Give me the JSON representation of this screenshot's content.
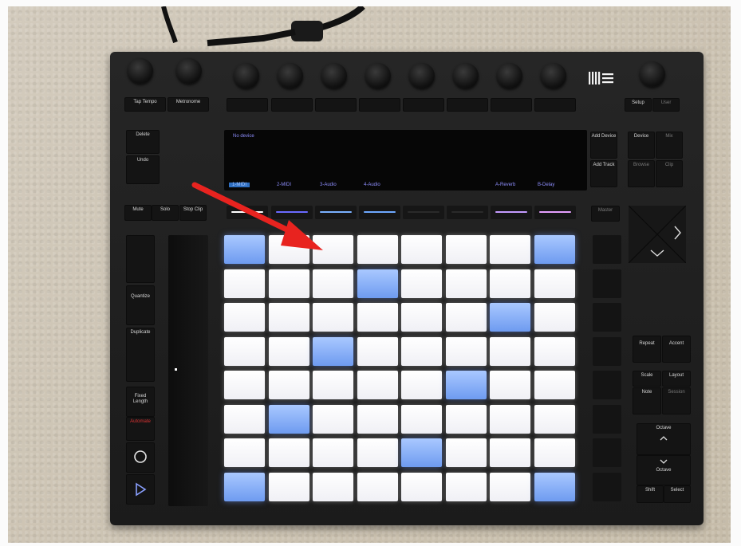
{
  "device": {
    "top_buttons": {
      "tap_tempo": "Tap Tempo",
      "metronome": "Metronome",
      "setup": "Setup",
      "user": "User"
    },
    "left_buttons": {
      "delete": "Delete",
      "undo": "Undo",
      "mute": "Mute",
      "solo": "Solo",
      "stop_clip": "Stop Clip",
      "quantize": "Quantize",
      "duplicate": "Duplicate",
      "fixed_length": "Fixed Length",
      "automate": "Automate",
      "record_icon": "record-icon",
      "play_icon": "play-icon"
    },
    "display": {
      "status": "No device",
      "tracks": [
        "1-MIDI",
        "2-MIDI",
        "3-Audio",
        "4-Audio",
        "A-Reverb",
        "B-Delay"
      ],
      "selected_track": "1-MIDI"
    },
    "right_buttons": {
      "add_device": "Add Device",
      "add_track": "Add Track",
      "device": "Device",
      "mix": "Mix",
      "browse": "Browse",
      "clip": "Clip",
      "master": "Master",
      "repeat": "Repeat",
      "accent": "Accent",
      "scale": "Scale",
      "layout": "Layout",
      "note": "Note",
      "session": "Session",
      "octave_up": "Octave",
      "octave_down": "Octave",
      "shift": "Shift",
      "select": "Select"
    },
    "pad_grid": {
      "rows": 8,
      "cols": 8,
      "colors": {
        "white": "#f7f7fb",
        "blue": "#7ea6f5"
      },
      "blue_pads": [
        [
          0,
          0
        ],
        [
          0,
          7
        ],
        [
          1,
          3
        ],
        [
          2,
          6
        ],
        [
          3,
          2
        ],
        [
          4,
          5
        ],
        [
          5,
          1
        ],
        [
          6,
          4
        ],
        [
          7,
          0
        ],
        [
          7,
          7
        ]
      ]
    },
    "strip_led_colors": [
      "#ffffff",
      "#6a6aff",
      "#7ab0ff",
      "#6ea8ff",
      "#2a2a2a",
      "#2a2a2a",
      "#c49bff",
      "#e6a0ff"
    ]
  },
  "annotation": {
    "arrow_color": "#e8231f"
  }
}
